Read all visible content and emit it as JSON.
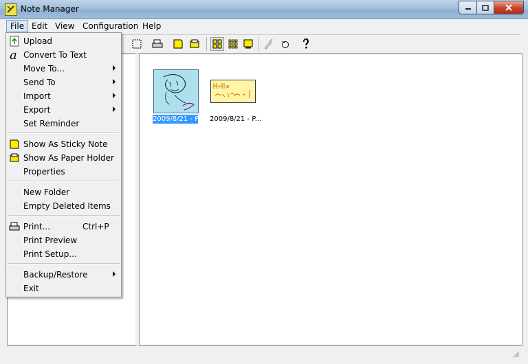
{
  "window": {
    "title": "Note Manager"
  },
  "menubar": [
    {
      "label": "File",
      "active": true
    },
    {
      "label": "Edit"
    },
    {
      "label": "View"
    },
    {
      "label": "Configuration"
    },
    {
      "label": "Help"
    }
  ],
  "file_menu": {
    "items": [
      {
        "label": "Upload",
        "icon": "upload-icon"
      },
      {
        "label": "Convert To Text",
        "icon": "convert-text-icon"
      },
      {
        "label": "Move To...",
        "submenu": true
      },
      {
        "label": "Send To",
        "submenu": true
      },
      {
        "label": "Import",
        "submenu": true
      },
      {
        "label": "Export",
        "submenu": true
      },
      {
        "label": "Set Reminder"
      },
      {
        "label": "Show As Sticky Note",
        "icon": "sticky-note-icon"
      },
      {
        "label": "Show As Paper Holder",
        "icon": "paper-holder-icon"
      },
      {
        "label": "Properties"
      },
      {
        "label": "New Folder"
      },
      {
        "label": "Empty Deleted Items"
      },
      {
        "label": "Print...",
        "shortcut": "Ctrl+P",
        "icon": "printer-icon"
      },
      {
        "label": "Print Preview"
      },
      {
        "label": "Print Setup..."
      },
      {
        "label": "Backup/Restore",
        "submenu": true
      },
      {
        "label": "Exit"
      }
    ]
  },
  "notes": [
    {
      "caption": "2009/8/21 - P...",
      "selected": true
    },
    {
      "caption": "2009/8/21 - P..."
    }
  ],
  "colors": {
    "selection": "#3399ff",
    "note_blue": "#aee0ec",
    "note_yellow": "#fff4a8"
  }
}
